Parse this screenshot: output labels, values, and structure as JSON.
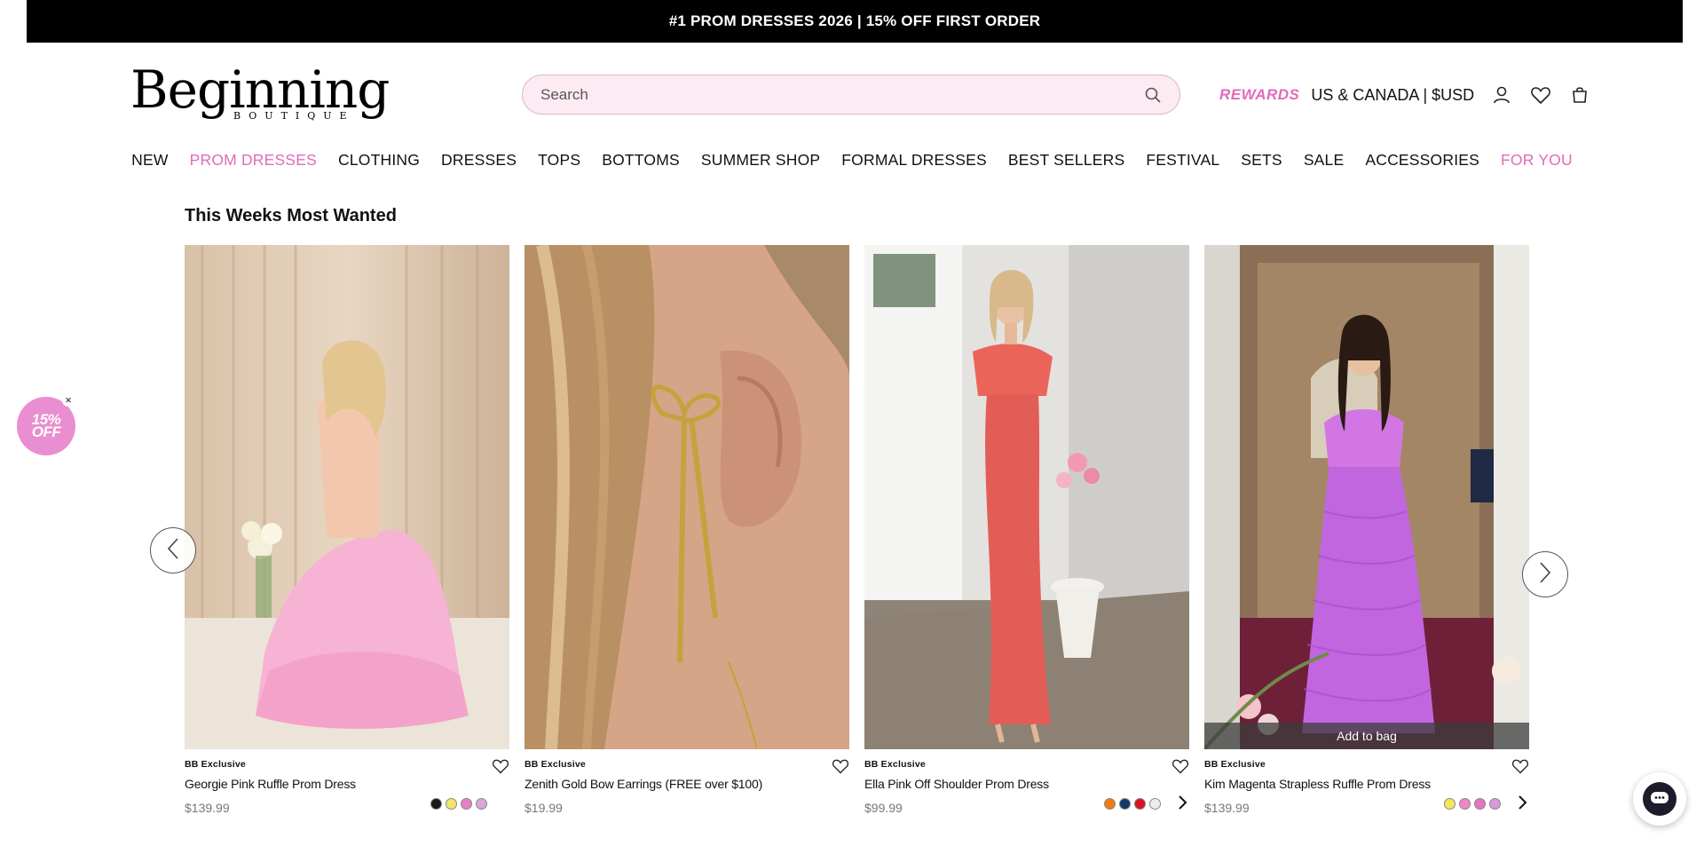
{
  "announcement": "#1 PROM DRESSES 2026 | 15% OFF FIRST ORDER",
  "logo": {
    "main": "Beginning",
    "sub": "BOUTIQUE"
  },
  "search": {
    "placeholder": "Search"
  },
  "header": {
    "rewards": "REWARDS",
    "region": "US & CANADA | $USD"
  },
  "nav": [
    {
      "label": "NEW",
      "accent": false
    },
    {
      "label": "PROM DRESSES",
      "accent": true
    },
    {
      "label": "CLOTHING",
      "accent": false
    },
    {
      "label": "DRESSES",
      "accent": false
    },
    {
      "label": "TOPS",
      "accent": false
    },
    {
      "label": "BOTTOMS",
      "accent": false
    },
    {
      "label": "SUMMER SHOP",
      "accent": false
    },
    {
      "label": "FORMAL DRESSES",
      "accent": false
    },
    {
      "label": "BEST SELLERS",
      "accent": false
    },
    {
      "label": "FESTIVAL",
      "accent": false
    },
    {
      "label": "SETS",
      "accent": false
    },
    {
      "label": "SALE",
      "accent": false
    },
    {
      "label": "ACCESSORIES",
      "accent": false
    },
    {
      "label": "FOR YOU",
      "accent": true
    }
  ],
  "section_title": "This Weeks Most Wanted",
  "products": [
    {
      "brand": "BB Exclusive",
      "name": "Georgie Pink Ruffle Prom Dress",
      "price": "$139.99",
      "swatches": [
        "#1a1a1a",
        "#f2e36b",
        "#e87fc4",
        "#d9a6d6"
      ],
      "has_more": false,
      "add_to_bag": ""
    },
    {
      "brand": "BB Exclusive",
      "name": "Zenith Gold Bow Earrings (FREE over $100)",
      "price": "$19.99",
      "swatches": [],
      "has_more": false,
      "add_to_bag": ""
    },
    {
      "brand": "BB Exclusive",
      "name": "Ella Pink Off Shoulder Prom Dress",
      "price": "$99.99",
      "swatches": [
        "#f07d12",
        "#133a6a",
        "#d8141c",
        "#ececec"
      ],
      "has_more": true,
      "add_to_bag": ""
    },
    {
      "brand": "BB Exclusive",
      "name": "Kim Magenta Strapless Ruffle Prom Dress",
      "price": "$139.99",
      "swatches": [
        "#f4e75a",
        "#ef86c6",
        "#e873c0",
        "#d79adb"
      ],
      "has_more": true,
      "add_to_bag": "Add to bag"
    }
  ],
  "promo_badge": {
    "line1": "15%",
    "line2": "OFF"
  },
  "colors": {
    "accent": "#e06bbd",
    "search_bg": "#fdebf3",
    "bar": "#000000"
  }
}
